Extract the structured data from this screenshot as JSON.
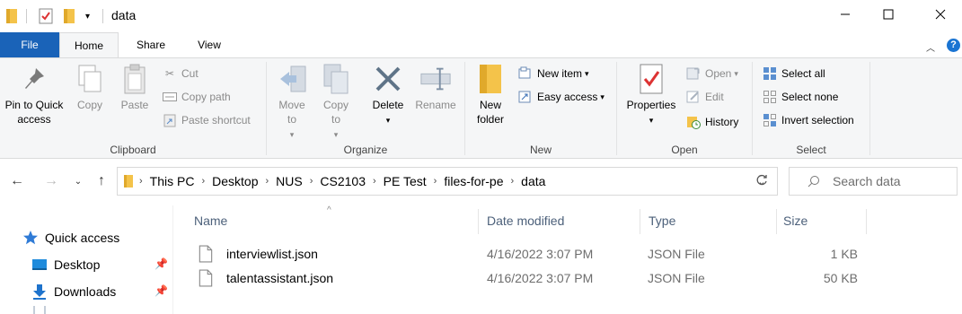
{
  "window": {
    "title": "data",
    "controls": {
      "minimize": "minimize-icon",
      "maximize": "maximize-icon",
      "close": "close-icon"
    }
  },
  "ribbon_tabs": [
    "File",
    "Home",
    "Share",
    "View"
  ],
  "ribbon": {
    "clipboard": {
      "label": "Clipboard",
      "pin_to_quick_access": "Pin to Quick access",
      "copy": "Copy",
      "paste": "Paste",
      "cut": "Cut",
      "copy_path": "Copy path",
      "paste_shortcut": "Paste shortcut"
    },
    "organize": {
      "label": "Organize",
      "move_to": "Move to",
      "copy_to": "Copy to",
      "delete": "Delete",
      "rename": "Rename"
    },
    "new": {
      "label": "New",
      "new_folder": "New folder",
      "new_item": "New item",
      "easy_access": "Easy access"
    },
    "open": {
      "label": "Open",
      "properties": "Properties",
      "open": "Open",
      "edit": "Edit",
      "history": "History"
    },
    "select": {
      "label": "Select",
      "select_all": "Select all",
      "select_none": "Select none",
      "invert_selection": "Invert selection"
    }
  },
  "address": {
    "breadcrumbs": [
      "This PC",
      "Desktop",
      "NUS",
      "CS2103",
      "PE Test",
      "files-for-pe",
      "data"
    ],
    "search_placeholder": "Search data"
  },
  "nav_pane": {
    "items": [
      "Quick access",
      "Desktop",
      "Downloads"
    ]
  },
  "file_list": {
    "columns": [
      "Name",
      "Date modified",
      "Type",
      "Size"
    ],
    "rows": [
      {
        "name": "interviewlist.json",
        "date": "4/16/2022 3:07 PM",
        "type": "JSON File",
        "size": "1 KB"
      },
      {
        "name": "talentassistant.json",
        "date": "4/16/2022 3:07 PM",
        "type": "JSON File",
        "size": "50 KB"
      }
    ]
  },
  "colors": {
    "accent": "#1a63b8",
    "folder": "#f4c34a",
    "header_text": "#4c607a"
  }
}
